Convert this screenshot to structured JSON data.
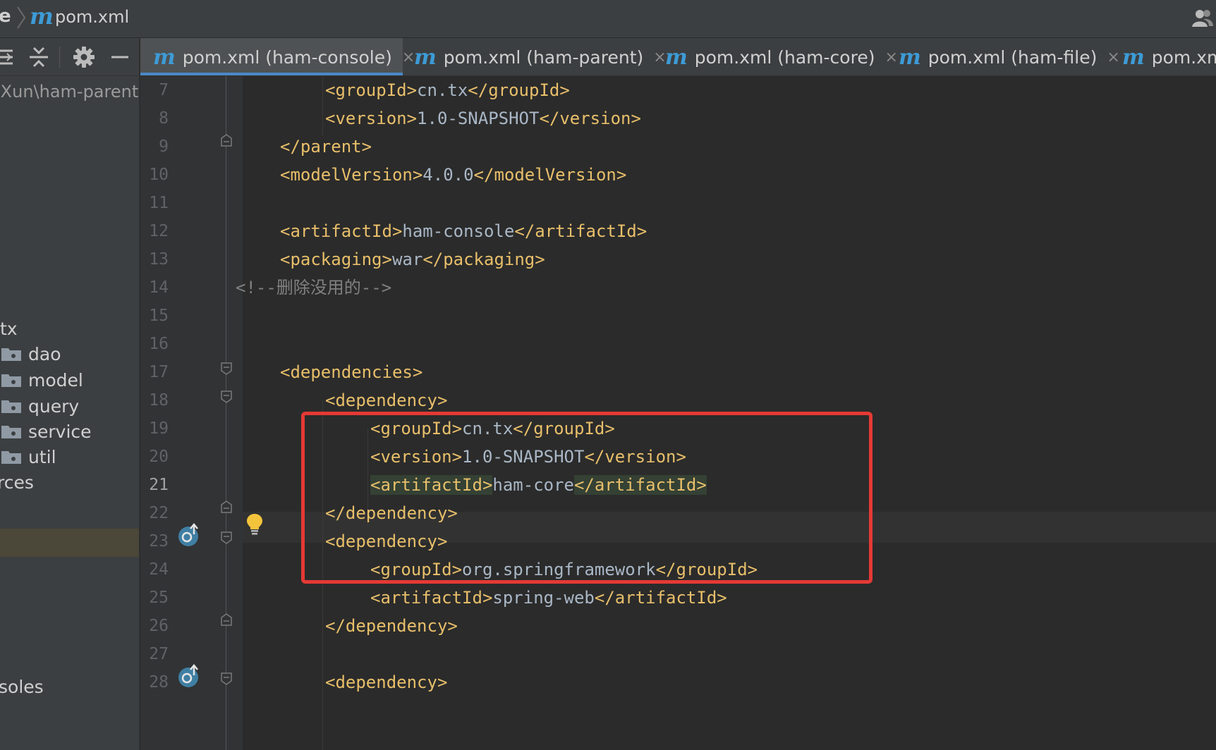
{
  "navbar": {
    "crumb_prev": "e",
    "crumb_icon": "m",
    "crumb_file": "pom.xml"
  },
  "sidebar": {
    "path": "iXun\\ham-parent",
    "items": [
      {
        "label": "tx",
        "folder": false
      },
      {
        "label": "dao",
        "folder": true
      },
      {
        "label": "model",
        "folder": true
      },
      {
        "label": "query",
        "folder": true
      },
      {
        "label": "service",
        "folder": true
      },
      {
        "label": "util",
        "folder": true
      },
      {
        "label": "rces",
        "folder": false
      },
      {
        "label": "soles",
        "folder": false
      }
    ]
  },
  "tabs": [
    {
      "icon": "m",
      "label": "pom.xml (ham-console)",
      "active": true
    },
    {
      "icon": "m",
      "label": "pom.xml (ham-parent)",
      "active": false
    },
    {
      "icon": "m",
      "label": "pom.xml (ham-core)",
      "active": false
    },
    {
      "icon": "m",
      "label": "pom.xml (ham-file)",
      "active": false
    },
    {
      "icon": "m",
      "label": "pom.xm",
      "active": false
    }
  ],
  "close_symbol": "×",
  "editor": {
    "current_line": "21",
    "lines": [
      {
        "num": "7",
        "t1": "<groupId>",
        "v": "cn.tx",
        "t2": "</groupId>"
      },
      {
        "num": "8",
        "t1": "<version>",
        "v": "1.0-SNAPSHOT",
        "t2": "</version>"
      },
      {
        "num": "9",
        "t1": "</parent>",
        "v": "",
        "t2": ""
      },
      {
        "num": "10",
        "t1": "<modelVersion>",
        "v": "4.0.0",
        "t2": "</modelVersion>"
      },
      {
        "num": "11",
        "t1": "",
        "v": "",
        "t2": ""
      },
      {
        "num": "12",
        "t1": "<artifactId>",
        "v": "ham-console",
        "t2": "</artifactId>"
      },
      {
        "num": "13",
        "t1": "<packaging>",
        "v": "war",
        "t2": "</packaging>"
      },
      {
        "num": "14",
        "comment": "<!--删除没用的-->"
      },
      {
        "num": "15",
        "t1": "",
        "v": "",
        "t2": ""
      },
      {
        "num": "16",
        "t1": "",
        "v": "",
        "t2": ""
      },
      {
        "num": "17",
        "t1": "<dependencies>",
        "v": "",
        "t2": ""
      },
      {
        "num": "18",
        "t1": "<dependency>",
        "v": "",
        "t2": ""
      },
      {
        "num": "19",
        "t1": "<groupId>",
        "v": "cn.tx",
        "t2": "</groupId>"
      },
      {
        "num": "20",
        "t1": "<version>",
        "v": "1.0-SNAPSHOT",
        "t2": "</version>"
      },
      {
        "num": "21",
        "t1": "<artifactId>",
        "v": "ham-core",
        "t2": "</artifactId>"
      },
      {
        "num": "22",
        "t1": "</dependency>",
        "v": "",
        "t2": ""
      },
      {
        "num": "23",
        "t1": "<dependency>",
        "v": "",
        "t2": ""
      },
      {
        "num": "24",
        "t1": "<groupId>",
        "v": "org.springframework",
        "t2": "</groupId>"
      },
      {
        "num": "25",
        "t1": "<artifactId>",
        "v": "spring-web",
        "t2": "</artifactId>"
      },
      {
        "num": "26",
        "t1": "</dependency>",
        "v": "",
        "t2": ""
      },
      {
        "num": "27",
        "t1": "",
        "v": "",
        "t2": ""
      },
      {
        "num": "28",
        "t1": "<dependency>",
        "v": "",
        "t2": ""
      }
    ]
  },
  "colors": {
    "tag": "#e8bf6a",
    "text": "#a9b7c6",
    "comment": "#808080",
    "accent": "#4a88c7",
    "highlight_box": "#e53935"
  },
  "icons": [
    "user-icon",
    "expand-all-icon",
    "collapse-all-icon",
    "gear-icon",
    "minimize-icon",
    "folder-icon",
    "lightbulb-icon",
    "override-icon",
    "fold-icon"
  ]
}
